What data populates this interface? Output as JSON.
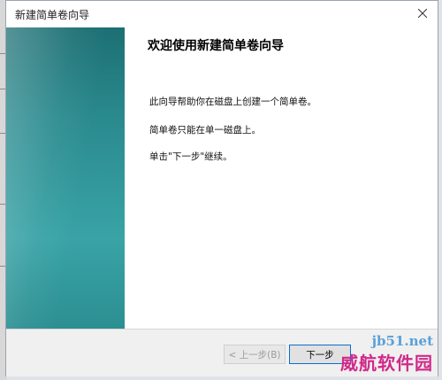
{
  "window": {
    "title": "新建简单卷向导"
  },
  "content": {
    "heading": "欢迎使用新建简单卷向导",
    "paragraphs": [
      "此向导帮助你在磁盘上创建一个简单卷。",
      "简单卷只能在单一磁盘上。",
      "单击\"下一步\"继续。"
    ]
  },
  "buttons": {
    "back": "< 上一步(B)",
    "next": "下一步"
  },
  "watermark": {
    "url": "jb51.net",
    "text": "威航软件园"
  },
  "colors": {
    "banner": "#2a8a8e",
    "focus_border": "#0a6ed1",
    "watermark_text": "#d02a8a"
  }
}
